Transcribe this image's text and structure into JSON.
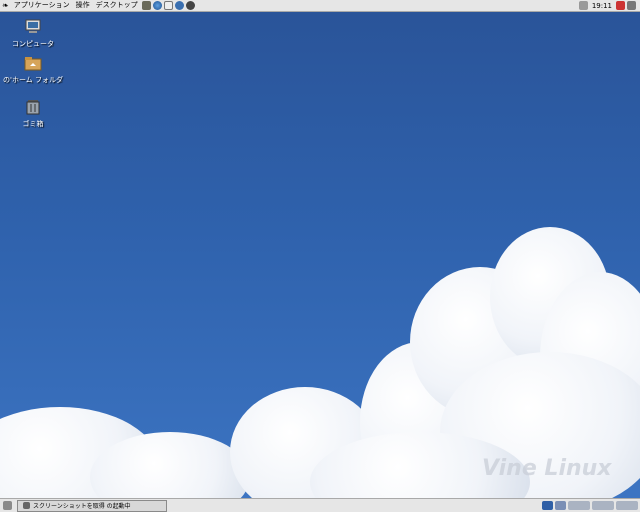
{
  "top_panel": {
    "menus": [
      "アプリケーション",
      "操作",
      "デスクトップ"
    ],
    "launchers": [
      "text-editor-icon",
      "browser-globe-icon",
      "mail-icon",
      "help-icon",
      "settings-icon"
    ],
    "clock": "19:11"
  },
  "desktop": {
    "icons": [
      {
        "label": "コンピュータ",
        "icon": "computer-icon"
      },
      {
        "label": "の'ホーム フォルダ",
        "icon": "home-folder-icon"
      },
      {
        "label": "ゴミ箱",
        "icon": "trash-icon"
      }
    ],
    "watermark": "Vine Linux"
  },
  "bottom_panel": {
    "task_label": "スクリーンショットを取得 の起動中"
  }
}
